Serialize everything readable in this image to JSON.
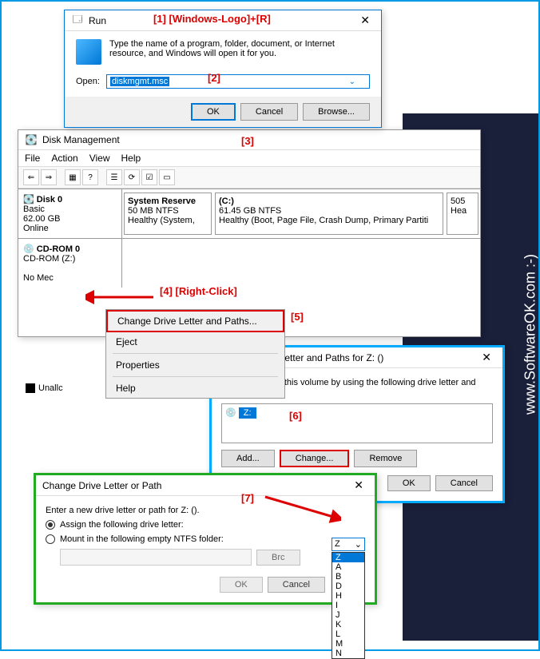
{
  "watermark": "www.SoftwareOK.com :-)",
  "annotations": {
    "a1": "[1]  [Windows-Logo]+[R]",
    "a2": "[2]",
    "a3": "[3]",
    "a4": "[4]  [Right-Click]",
    "a5": "[5]",
    "a6": "[6]",
    "a7": "[7]"
  },
  "run": {
    "title": "Run",
    "desc": "Type the name of a program, folder, document, or Internet resource, and Windows will open it for you.",
    "open_label": "Open:",
    "input_value": "diskmgmt.msc",
    "ok": "OK",
    "cancel": "Cancel",
    "browse": "Browse..."
  },
  "diskmgmt": {
    "title": "Disk Management",
    "menu": {
      "file": "File",
      "action": "Action",
      "view": "View",
      "help": "Help"
    },
    "disk0": {
      "name": "Disk 0",
      "type": "Basic",
      "size": "62.00 GB",
      "status": "Online"
    },
    "part1": {
      "name": "System Reserve",
      "size": "50 MB NTFS",
      "status": "Healthy (System,"
    },
    "part2": {
      "name": "(C:)",
      "size": "61.45 GB NTFS",
      "status": "Healthy (Boot, Page File, Crash Dump, Primary Partiti"
    },
    "part3": {
      "size": "505",
      "status": "Hea"
    },
    "cdrom": {
      "name": "CD-ROM 0",
      "sub": "CD-ROM (Z:)",
      "nomedia": "No Mec"
    },
    "unallocated": "Unallc"
  },
  "context": {
    "change": "Change Drive Letter and Paths...",
    "eject": "Eject",
    "properties": "Properties",
    "help": "Help"
  },
  "change_dialog": {
    "title": "Change Drive Letter and Paths for Z: ()",
    "desc": "Allow access to this volume by using the following drive letter and paths:",
    "drive": "Z:",
    "add": "Add...",
    "change": "Change...",
    "remove": "Remove",
    "ok": "OK",
    "cancel": "Cancel"
  },
  "path_dialog": {
    "title": "Change Drive Letter or Path",
    "desc": "Enter a new drive letter or path for Z: ().",
    "assign": "Assign the following drive letter:",
    "mount": "Mount in the following empty NTFS folder:",
    "browse": "Brc",
    "ok": "OK",
    "cancel": "Cancel",
    "selected": "Z",
    "options": [
      "Z",
      "A",
      "B",
      "D",
      "H",
      "I",
      "J",
      "K",
      "L",
      "M",
      "N"
    ]
  }
}
